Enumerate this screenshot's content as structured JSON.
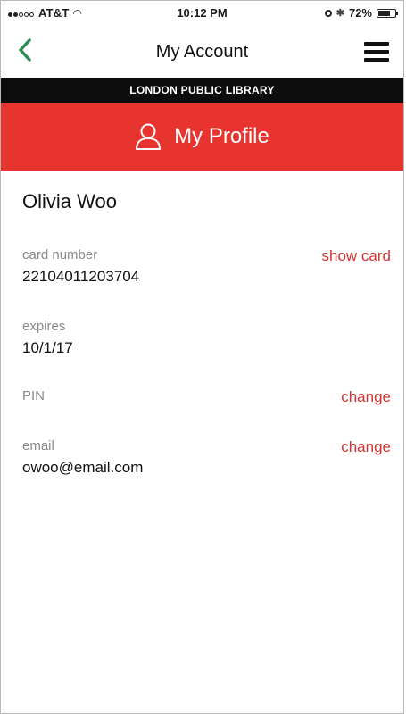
{
  "status_bar": {
    "carrier": "AT&T",
    "time": "10:12 PM",
    "battery": "72%",
    "battery_level": 0.72
  },
  "nav": {
    "title": "My Account"
  },
  "library_name": "LONDON PUBLIC LIBRARY",
  "header": {
    "title": "My Profile"
  },
  "profile": {
    "name": "Olivia Woo",
    "card": {
      "label": "card number",
      "value": "22104011203704",
      "action": "show card"
    },
    "expires": {
      "label": "expires",
      "value": "10/1/17"
    },
    "pin": {
      "label": "PIN",
      "action": "change"
    },
    "email": {
      "label": "email",
      "value": "owoo@email.com",
      "action": "change"
    }
  },
  "colors": {
    "accent_red": "#e8342f",
    "link_red": "#d6322e",
    "back_green": "#2e8b57",
    "banner_black": "#0d0d0d"
  },
  "icons": {
    "back": "chevron-left-icon",
    "menu": "hamburger-menu-icon",
    "profile": "user-outline-icon"
  }
}
